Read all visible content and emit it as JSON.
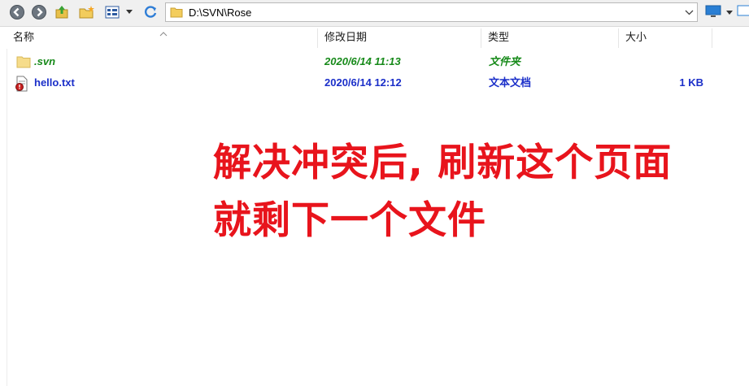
{
  "toolbar": {
    "address": "D:\\SVN\\Rose"
  },
  "columns": {
    "name": "名称",
    "modified": "修改日期",
    "type": "类型",
    "size": "大小"
  },
  "files": [
    {
      "name": ".svn",
      "modified": "2020/6/14 11:13",
      "type": "文件夹",
      "size": ""
    },
    {
      "name": "hello.txt",
      "modified": "2020/6/14 12:12",
      "type": "文本文档",
      "size": "1 KB"
    }
  ],
  "annotation": {
    "line1": "解决冲突后, 刷新这个页面",
    "line2": "就剩下一个文件"
  },
  "colors": {
    "annotation": "#e8141c",
    "svn_text": "#178a1a",
    "file_text": "#1b2fc9"
  }
}
